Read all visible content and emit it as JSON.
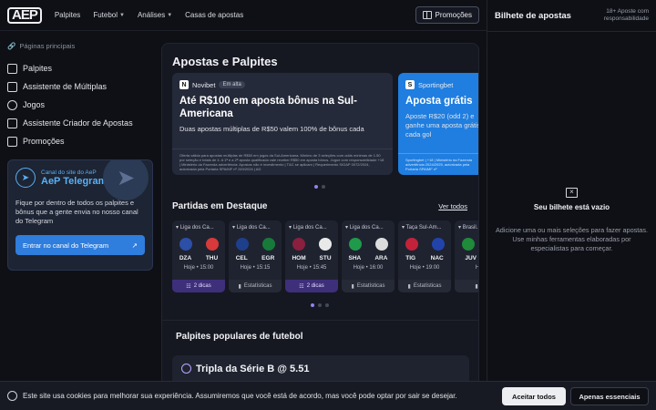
{
  "header": {
    "logo": "AEP",
    "nav": [
      {
        "label": "Palpites",
        "has_dropdown": false
      },
      {
        "label": "Futebol",
        "has_dropdown": true
      },
      {
        "label": "Análises",
        "has_dropdown": true
      },
      {
        "label": "Casas de apostas",
        "has_dropdown": false
      }
    ],
    "promo_button": "Promoções"
  },
  "sidebar": {
    "heading": "Páginas principais",
    "items": [
      {
        "label": "Palpites",
        "icon": "chart-icon"
      },
      {
        "label": "Assistente de Múltiplas",
        "icon": "layers-icon"
      },
      {
        "label": "Jogos",
        "icon": "ball-icon"
      },
      {
        "label": "Assistente Criador de Apostas",
        "icon": "builder-icon"
      },
      {
        "label": "Promoções",
        "icon": "tag-icon"
      }
    ],
    "telegram": {
      "small": "Canal do site do AeP",
      "title": "AeP Telegram!",
      "text": "Fique por dentro de todos os palpites e bônus que a gente envia no nosso canal do Telegram",
      "button": "Entrar no canal do Telegram"
    }
  },
  "main": {
    "title": "Apostas e Palpites",
    "promos": [
      {
        "bookmaker": "Novibet",
        "badge": "Em alta",
        "title": "Até R$100 em aposta bônus na Sul-Americana",
        "sub": "Duas apostas múltiplas de R$50 valem 100% de bônus cada",
        "fine": "Oferta válida para apostas múltiplas de R$50 em jogos da Sul-Americana. Mínimo de 3 seleções com odds mínimas de 1.50 por seleção e totais de 4. A 1ª e a 2ª aposta qualificada vale receber R$50 em aposta bônus. Jogue com responsabilidade +18 | Ministério da Fazenda advertência: Apostas não é investimento | T&C se aplicam | Requerimento SIGAP 0072/2024, autorizada pela Portaria SPA/MF nº 249/2024 | AD"
      },
      {
        "bookmaker": "Sportingbet",
        "badge": "",
        "title": "Aposta grátis",
        "sub": "Aposte R$20 (odd 2) e ganhe uma aposta grátis a cada gol",
        "fine": "Sportingbet | +18 | Ministério da Fazenda advertência 2024/2025, autorizada pela Portaria SPA/MF nº"
      }
    ],
    "featured_title": "Partidas em Destaque",
    "see_all": "Ver todos",
    "matches": [
      {
        "league": "Liga dos Ca...",
        "home": "DZA",
        "away": "THU",
        "time": "Hoje • 15:00",
        "footer": "2 dicas",
        "footer_type": "dicas",
        "home_color": "#2c4fa8",
        "away_color": "#d63a3a"
      },
      {
        "league": "Liga dos Ca...",
        "home": "CEL",
        "away": "EGR",
        "time": "Hoje • 15:15",
        "footer": "Estatísticas",
        "footer_type": "stats",
        "home_color": "#1e3f8a",
        "away_color": "#177a3a"
      },
      {
        "league": "Liga dos Ca...",
        "home": "HOM",
        "away": "STU",
        "time": "Hoje • 15:45",
        "footer": "2 dicas",
        "footer_type": "dicas",
        "home_color": "#8a1f3e",
        "away_color": "#e9e9e9"
      },
      {
        "league": "Liga dos Ca...",
        "home": "SHA",
        "away": "ARA",
        "time": "Hoje • 16:00",
        "footer": "Estatísticas",
        "footer_type": "stats",
        "home_color": "#1f9a4a",
        "away_color": "#dcdcdc"
      },
      {
        "league": "Taça Sul-Am...",
        "home": "TIG",
        "away": "NAC",
        "time": "Hoje • 19:00",
        "footer": "Estatísticas",
        "footer_type": "stats",
        "home_color": "#c3223a",
        "away_color": "#2244aa"
      },
      {
        "league": "Brasil...",
        "home": "JUV",
        "away": "",
        "time": "Hoje",
        "footer": "Es",
        "footer_type": "stats",
        "home_color": "#1f8a3a",
        "away_color": "#1f2330"
      }
    ],
    "popular_title": "Palpites populares de futebol",
    "popular_card": "Tripla da Série B @ 5.51"
  },
  "betslip": {
    "title": "Bilhete de apostas",
    "responsibility": "18+ Aposte com responsabilidade",
    "empty_title": "Seu bilhete está vazio",
    "empty_text": "Adicione uma ou mais seleções para fazer apostas. Use minhas ferramentas elaboradas por especialistas para começar."
  },
  "cookie": {
    "text": "Este site usa cookies para melhorar sua experiência. Assumiremos que você está de acordo, mas você pode optar por sair se desejar.",
    "accept": "Aceitar todos",
    "essential": "Apenas essenciais"
  }
}
